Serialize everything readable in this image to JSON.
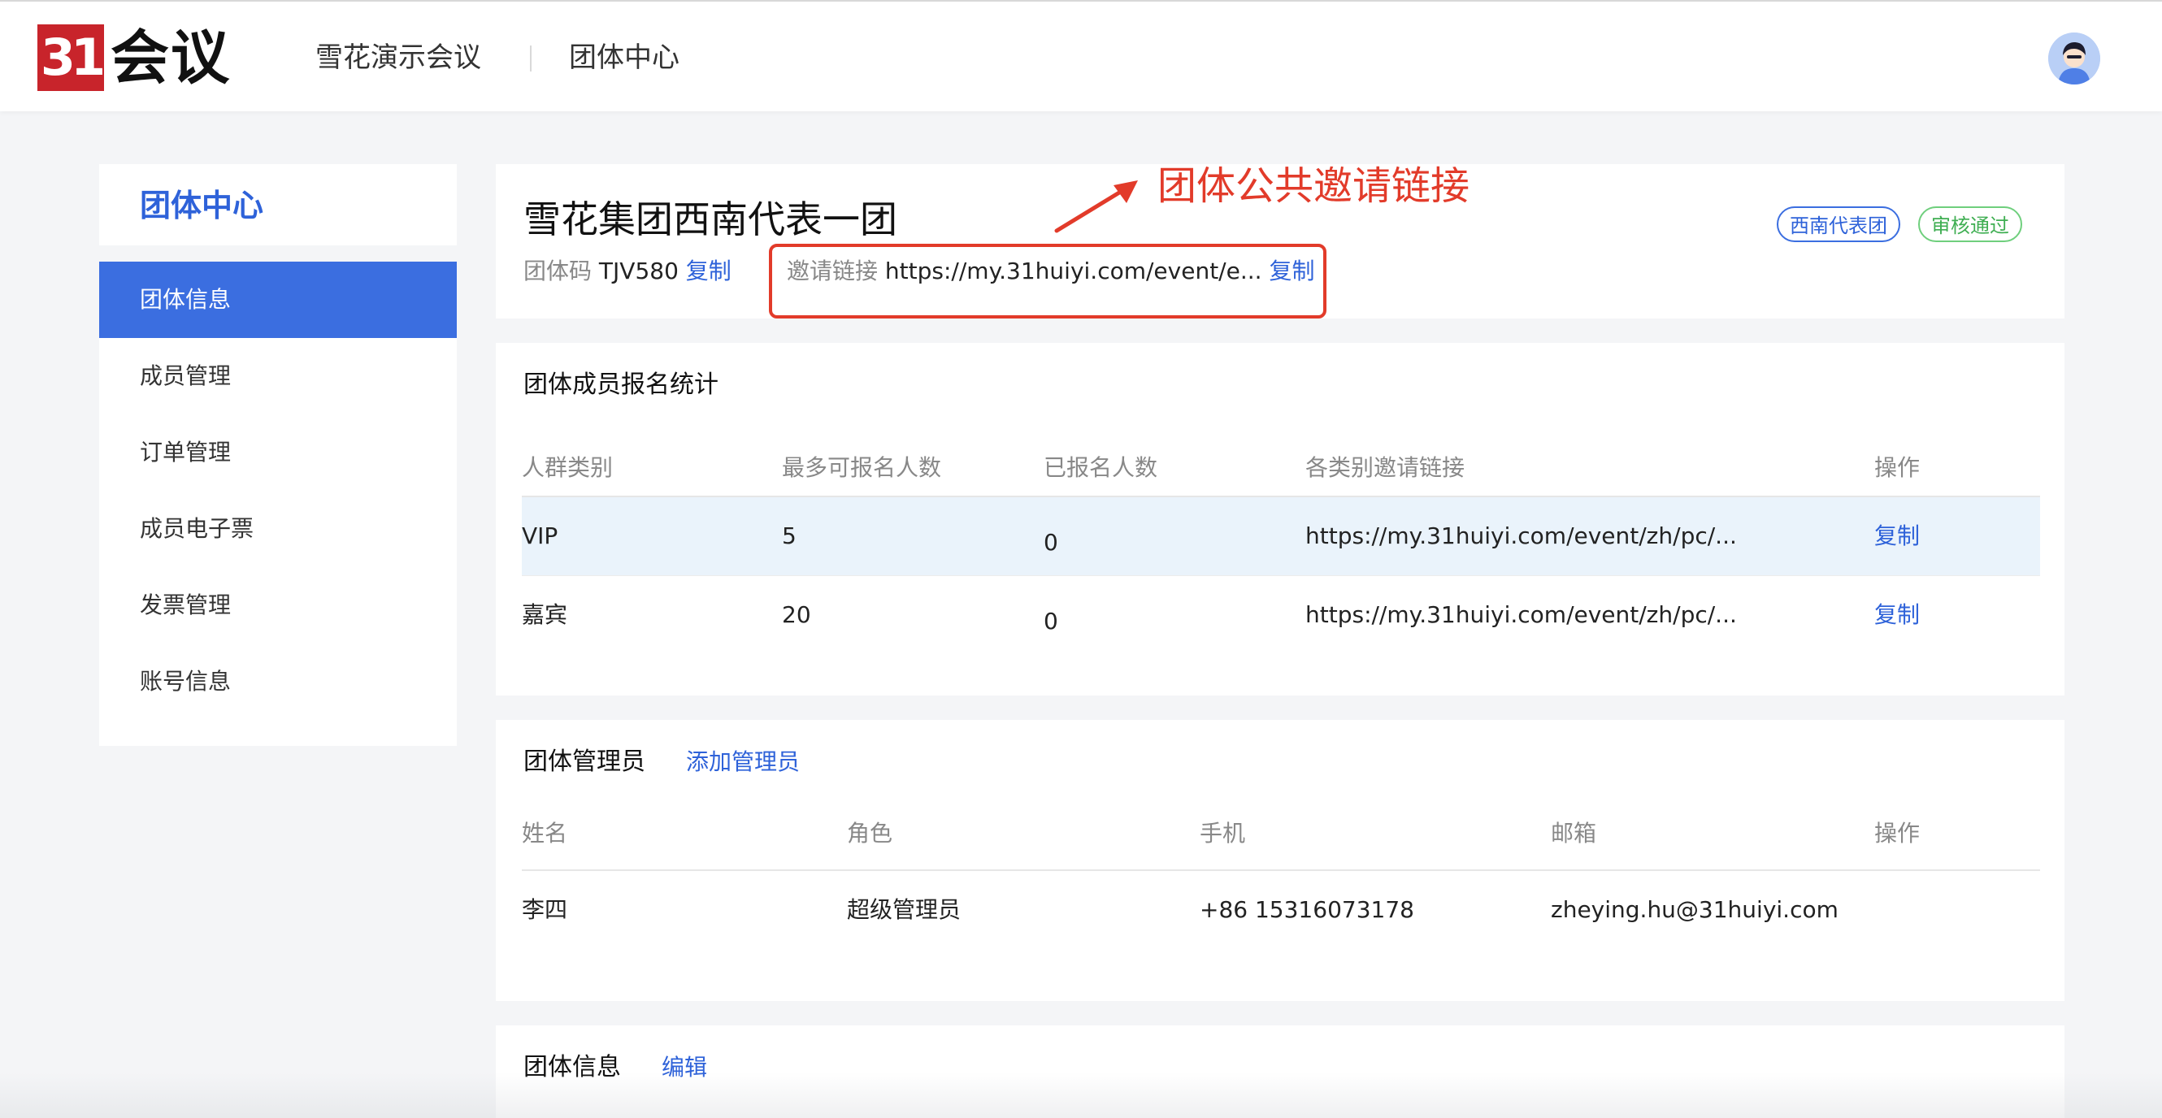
{
  "header": {
    "logo_number": "31",
    "logo_text": "会议",
    "event_name": "雪花演示会议",
    "center_name": "团体中心"
  },
  "sidebar": {
    "title": "团体中心",
    "items": [
      {
        "label": "团体信息",
        "active": true
      },
      {
        "label": "成员管理"
      },
      {
        "label": "订单管理"
      },
      {
        "label": "成员电子票"
      },
      {
        "label": "发票管理"
      },
      {
        "label": "账号信息"
      }
    ]
  },
  "group": {
    "name": "雪花集团西南代表一团",
    "code_label": "团体码",
    "code": "TJV580",
    "copy_label": "复制",
    "invite_label": "邀请链接",
    "invite_url": "https://my.31huiyi.com/event/e...",
    "invite_copy": "复制",
    "tags": [
      "西南代表团",
      "审核通过"
    ]
  },
  "annotation": {
    "label": "团体公共邀请链接",
    "color": "#e23b2a"
  },
  "stats": {
    "title": "团体成员报名统计",
    "columns": [
      "人群类别",
      "最多可报名人数",
      "已报名人数",
      "各类别邀请链接",
      "操作"
    ],
    "rows": [
      {
        "category": "VIP",
        "max": "5",
        "registered": "0",
        "link": "https://my.31huiyi.com/event/zh/pc/...",
        "action": "复制"
      },
      {
        "category": "嘉宾",
        "max": "20",
        "registered": "0",
        "link": "https://my.31huiyi.com/event/zh/pc/...",
        "action": "复制"
      }
    ]
  },
  "admins": {
    "title": "团体管理员",
    "add_label": "添加管理员",
    "columns": [
      "姓名",
      "角色",
      "手机",
      "邮箱",
      "操作"
    ],
    "rows": [
      {
        "name": "李四",
        "role": "超级管理员",
        "phone": "+86 15316073178",
        "email": "zheying.hu@31huiyi.com"
      }
    ]
  },
  "info": {
    "title": "团体信息",
    "edit_label": "编辑"
  },
  "colors": {
    "brand_red": "#c8242b",
    "primary_blue": "#3b6ee0",
    "success_green": "#3fae52",
    "row_highlight": "#eaf3fb"
  }
}
